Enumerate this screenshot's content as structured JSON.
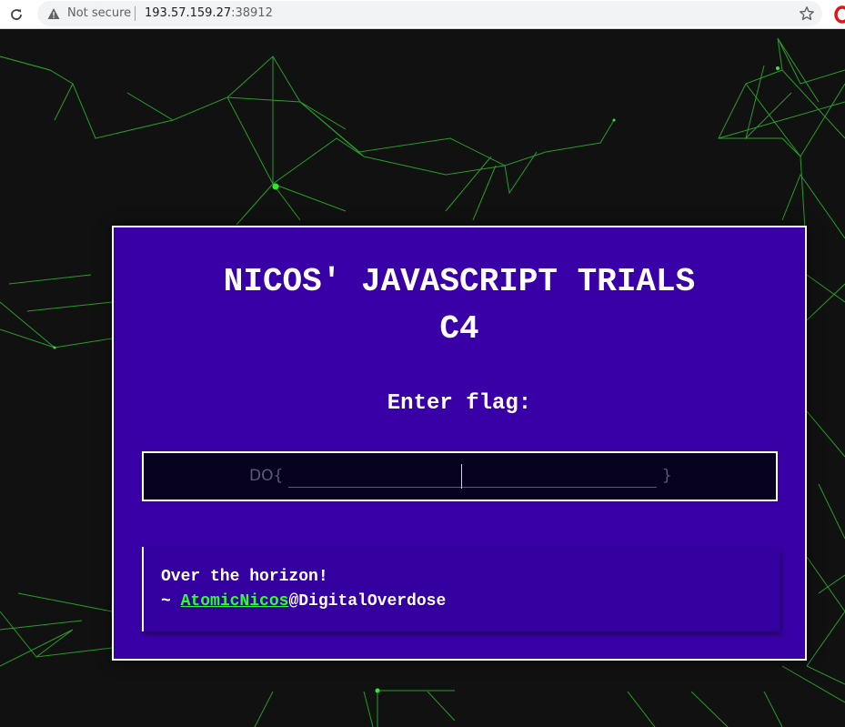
{
  "browser": {
    "security_label": "Not secure",
    "url_host": "193.57.159.27",
    "url_port": ":38912"
  },
  "page": {
    "title_line1": "NICOS' JAVASCRIPT TRIALS",
    "title_line2": "C4",
    "prompt": "Enter flag:",
    "flag_input": {
      "prefix": "DO{",
      "suffix": "}"
    },
    "quote": {
      "line1": "Over the horizon!",
      "tilde": "~ ",
      "author_link": "AtomicNicos",
      "author_suffix": "@DigitalOverdose"
    }
  },
  "colors": {
    "panel_bg": "#3a00a7",
    "quote_bg": "#3500a0",
    "input_bg": "#05011f",
    "link": "#2dff2d",
    "network": "#2ecc2e",
    "page_bg": "#111111"
  },
  "icons": {
    "reload": "reload-icon",
    "warning": "warning-triangle-icon",
    "bookmark": "star-icon",
    "extension": "opera-icon"
  }
}
